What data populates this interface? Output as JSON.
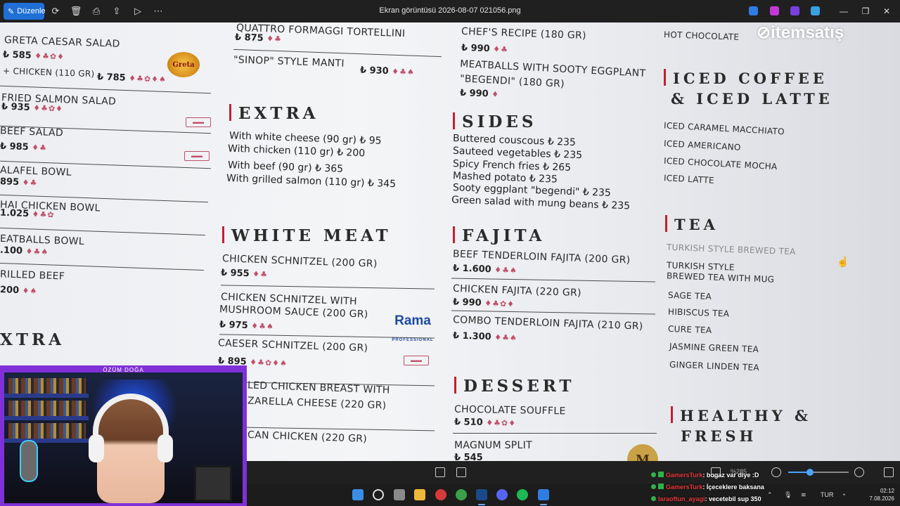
{
  "window": {
    "title": "Ekran görüntüsü 2026-08-07 021056.png"
  },
  "toolbar": {
    "edit_label": "Düzenle"
  },
  "viewer": {
    "zoom": "%285"
  },
  "photo": {
    "watermark": "itemsatış",
    "greta_logo": "Greta",
    "rama_logo": "Rama",
    "rama_sub": "PROFESSIONAL",
    "seal_letter": "M"
  },
  "menu": {
    "col1": [
      {
        "name": "GRETA CAESAR SALAD",
        "price": "₺ 585",
        "sub": "+ CHICKEN (110 GR)",
        "sub_price": "₺ 785"
      },
      {
        "name": "FRIED SALMON SALAD",
        "price": "₺ 935"
      },
      {
        "name": "BEEF SALAD",
        "price": "₺ 985"
      },
      {
        "name": "ALAFEL BOWL",
        "price": "895"
      },
      {
        "name": "HAI CHICKEN BOWL",
        "price": "1.025"
      },
      {
        "name": "EATBALLS BOWL",
        "price": ".100"
      },
      {
        "name": "RILLED BEEF",
        "price": "200"
      }
    ],
    "col1_extra_heading": "XTRA",
    "col2_top": [
      {
        "name": "QUATTRO FORMAGGI TORTELLINI",
        "price": "₺ 875"
      },
      {
        "name": "\"SINOP\" STYLE MANTI",
        "price": "₺ 930"
      }
    ],
    "extra": {
      "heading": "EXTRA",
      "items": [
        "With white cheese (90 gr) ₺ 95",
        "With chicken (110 gr) ₺ 200",
        "With beef (90 gr) ₺ 365",
        "With grilled salmon (110 gr) ₺ 345"
      ]
    },
    "white_meat": {
      "heading": "WHITE MEAT",
      "items": [
        {
          "name": "CHICKEN SCHNITZEL (200 GR)",
          "price": "₺ 955"
        },
        {
          "name": "CHICKEN SCHNITZEL WITH",
          "name2": "MUSHROOM SAUCE (200 GR)",
          "price": "₺ 975"
        },
        {
          "name": "CAESER SCHNITZEL (200 GR)",
          "price": "₺ 895"
        },
        {
          "name": "LED CHICKEN BREAST WITH",
          "name2": "ZARELLA CHEESE (220 GR)"
        },
        {
          "name": "CAN CHICKEN (220 GR)"
        }
      ]
    },
    "col3_top": [
      {
        "name": "CHEF'S RECIPE (180 GR)",
        "price": "₺ 990"
      },
      {
        "name": "MEATBALLS WITH SOOTY EGGPLANT",
        "name2": "\"BEGENDI\" (180 GR)",
        "price": "₺ 990"
      }
    ],
    "sides": {
      "heading": "SIDES",
      "items": [
        "Buttered couscous ₺ 235",
        "Sauteed vegetables ₺ 235",
        "Spicy French fries ₺ 265",
        "Mashed potato ₺ 235",
        "Sooty eggplant \"begendi\" ₺ 235",
        "Green salad with mung beans ₺ 235"
      ]
    },
    "fajita": {
      "heading": "FAJITA",
      "items": [
        {
          "name": "BEEF TENDERLOIN FAJITA (200 GR)",
          "price": "₺ 1.600"
        },
        {
          "name": "CHICKEN FAJITA (220 GR)",
          "price": "₺ 990"
        },
        {
          "name": "COMBO TENDERLOIN FAJITA (210 GR)",
          "price": "₺ 1.300"
        }
      ]
    },
    "dessert": {
      "heading": "DESSERT",
      "items": [
        {
          "name": "CHOCOLATE SOUFFLE",
          "price": "₺ 510"
        },
        {
          "name": "MAGNUM SPLIT",
          "price": "₺ 545"
        }
      ]
    },
    "col4_top": [
      "HOT CHOCOLATE"
    ],
    "iced": {
      "heading1": "ICED COFFEE",
      "heading2": "& ICED LATTE",
      "items": [
        "ICED CARAMEL MACCHIATO",
        "ICED AMERICANO",
        "ICED CHOCOLATE MOCHA",
        "ICED LATTE"
      ]
    },
    "tea": {
      "heading": "TEA",
      "items": [
        "TURKISH STYLE BREWED TEA",
        "TURKISH STYLE",
        "BREWED TEA WITH MUG",
        "SAGE TEA",
        "HIBISCUS TEA",
        "CURE TEA",
        "JASMINE GREEN TEA",
        "GINGER LINDEN TEA"
      ]
    },
    "healthy": {
      "heading1": "HEALTHY &",
      "heading2": "FRESH"
    }
  },
  "stream": {
    "streamer_name": "ÖZÜM DOĞA",
    "chat": [
      {
        "user": "GamersTurk",
        "text": ": bogaz var diye :D"
      },
      {
        "user": "GamersTurk",
        "text": ": İçeceklere baksana"
      },
      {
        "user": "laraoftun_ayagi",
        "text": ": vecetebil sup 350"
      }
    ]
  },
  "taskbar": {
    "language": "TUR",
    "time": "02:12",
    "date": "7.08.2026"
  }
}
